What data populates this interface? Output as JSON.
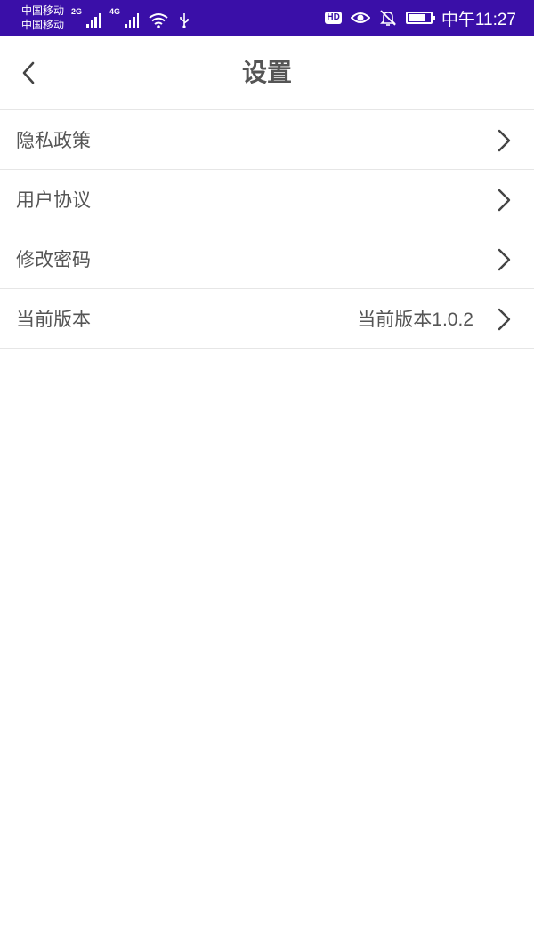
{
  "status_bar": {
    "carrier_1": "中国移动",
    "carrier_2": "中国移动",
    "network_1": "2G",
    "network_2": "4G",
    "hd_label": "HD",
    "time": "中午11:27",
    "background_color": "#3a0fa8"
  },
  "header": {
    "title": "设置",
    "back_icon": "chevron-left-icon"
  },
  "settings": {
    "items": [
      {
        "label": "隐私政策",
        "value": ""
      },
      {
        "label": "用户协议",
        "value": ""
      },
      {
        "label": "修改密码",
        "value": ""
      },
      {
        "label": "当前版本",
        "value": "当前版本1.0.2"
      }
    ],
    "row_icon": "chevron-right-icon"
  }
}
